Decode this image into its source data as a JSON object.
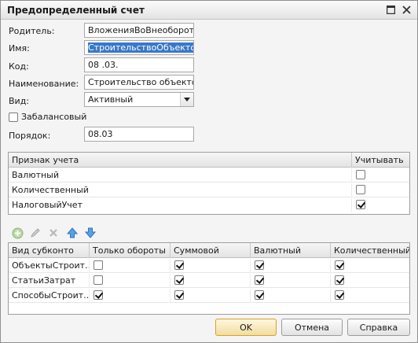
{
  "window": {
    "title": "Предопределенный счет"
  },
  "form": {
    "parent_label": "Родитель:",
    "parent_value": "ВложенияВоВнеоборотные",
    "name_label": "Имя:",
    "name_value": "СтроительствоОбъектовО",
    "code_label": "Код:",
    "code_value": "08 .03.",
    "title_label": "Наименование:",
    "title_value": "Строительство объектов с",
    "kind_label": "Вид:",
    "kind_value": "Активный",
    "offbalance_label": "Забалансовый",
    "offbalance_checked": false,
    "order_label": "Порядок:",
    "order_value": "08.03"
  },
  "accounting_table": {
    "headers": [
      "Признак учета",
      "Учитывать"
    ],
    "rows": [
      {
        "name": "Валютный",
        "checked": false
      },
      {
        "name": "Количественный",
        "checked": false
      },
      {
        "name": "НалоговыйУчет",
        "checked": true
      }
    ]
  },
  "toolbar": {
    "icons": [
      "add-icon",
      "edit-icon",
      "delete-icon",
      "move-up-icon",
      "move-down-icon"
    ]
  },
  "subconto_table": {
    "headers": [
      "Вид субконто",
      "Только обороты",
      "Суммовой",
      "Валютный",
      "Количественный"
    ],
    "rows": [
      {
        "name": "ОбъектыСтроит...",
        "turnover": false,
        "sum": true,
        "currency": true,
        "quantity": true
      },
      {
        "name": "СтатьиЗатрат",
        "turnover": false,
        "sum": true,
        "currency": true,
        "quantity": true
      },
      {
        "name": "СпособыСтроит...",
        "turnover": true,
        "sum": true,
        "currency": true,
        "quantity": true
      }
    ]
  },
  "buttons": {
    "ok": "OK",
    "cancel": "Отмена",
    "help": "Справка"
  },
  "colors": {
    "accent": "#3878c8",
    "default_button": "#f1dca0"
  }
}
